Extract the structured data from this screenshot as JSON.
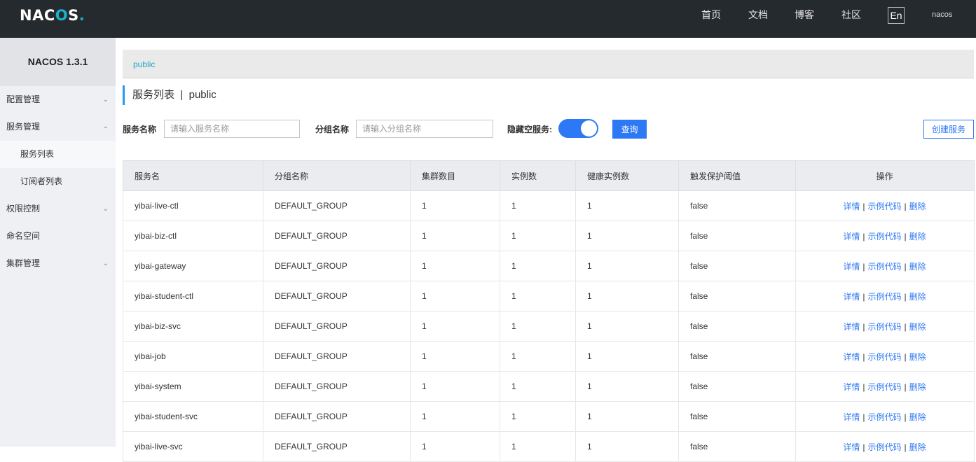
{
  "header": {
    "logo": "NAC",
    "logo_mark": "O",
    "logo_tail": "S",
    "logo_dot": ".",
    "nav": [
      "首页",
      "文档",
      "博客",
      "社区"
    ],
    "lang": "En",
    "user": "nacos"
  },
  "sidebar": {
    "title": "NACOS 1.3.1",
    "items": [
      {
        "label": "配置管理"
      },
      {
        "label": "服务管理"
      },
      {
        "label": "服务列表"
      },
      {
        "label": "订阅者列表"
      },
      {
        "label": "权限控制"
      },
      {
        "label": "命名空间"
      },
      {
        "label": "集群管理"
      }
    ]
  },
  "namespace": {
    "current": "public"
  },
  "page": {
    "title": "服务列表",
    "sep": "|",
    "namespace": "public"
  },
  "filters": {
    "service_label": "服务名称",
    "service_placeholder": "请输入服务名称",
    "group_label": "分组名称",
    "group_placeholder": "请输入分组名称",
    "hide_empty_label": "隐藏空服务:",
    "hide_empty": true,
    "query_label": "查询",
    "create_label": "创建服务"
  },
  "table": {
    "headers": [
      "服务名",
      "分组名称",
      "集群数目",
      "实例数",
      "健康实例数",
      "触发保护阈值",
      "操作"
    ],
    "actions": {
      "detail": "详情",
      "sample": "示例代码",
      "delete": "删除",
      "sep": "|"
    },
    "rows": [
      {
        "name": "yibai-live-ctl",
        "group": "DEFAULT_GROUP",
        "clusters": "1",
        "instances": "1",
        "healthy": "1",
        "threshold": "false"
      },
      {
        "name": "yibai-biz-ctl",
        "group": "DEFAULT_GROUP",
        "clusters": "1",
        "instances": "1",
        "healthy": "1",
        "threshold": "false"
      },
      {
        "name": "yibai-gateway",
        "group": "DEFAULT_GROUP",
        "clusters": "1",
        "instances": "1",
        "healthy": "1",
        "threshold": "false"
      },
      {
        "name": "yibai-student-ctl",
        "group": "DEFAULT_GROUP",
        "clusters": "1",
        "instances": "1",
        "healthy": "1",
        "threshold": "false"
      },
      {
        "name": "yibai-biz-svc",
        "group": "DEFAULT_GROUP",
        "clusters": "1",
        "instances": "1",
        "healthy": "1",
        "threshold": "false"
      },
      {
        "name": "yibai-job",
        "group": "DEFAULT_GROUP",
        "clusters": "1",
        "instances": "1",
        "healthy": "1",
        "threshold": "false"
      },
      {
        "name": "yibai-system",
        "group": "DEFAULT_GROUP",
        "clusters": "1",
        "instances": "1",
        "healthy": "1",
        "threshold": "false"
      },
      {
        "name": "yibai-student-svc",
        "group": "DEFAULT_GROUP",
        "clusters": "1",
        "instances": "1",
        "healthy": "1",
        "threshold": "false"
      },
      {
        "name": "yibai-live-svc",
        "group": "DEFAULT_GROUP",
        "clusters": "1",
        "instances": "1",
        "healthy": "1",
        "threshold": "false"
      }
    ]
  },
  "colors": {
    "primary": "#2d78f4",
    "topbar": "#252a2f",
    "namespace_link": "#1fa6c7"
  }
}
